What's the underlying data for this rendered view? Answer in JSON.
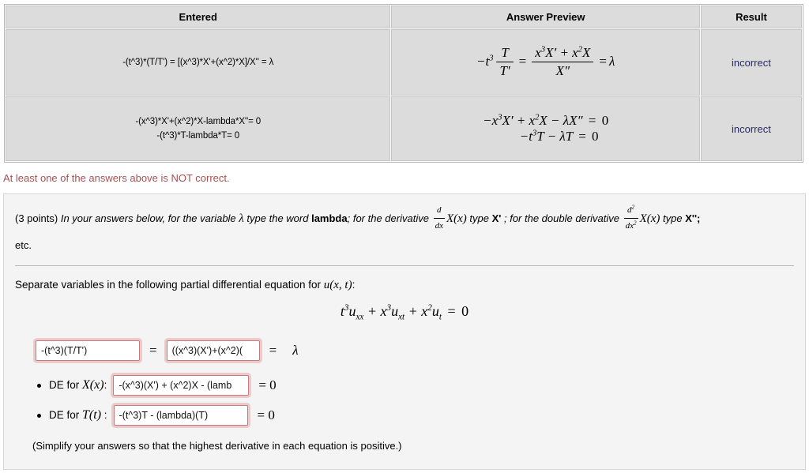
{
  "results_table": {
    "headers": [
      "Entered",
      "Answer Preview",
      "Result"
    ],
    "rows": [
      {
        "entered": "-(t^3)*(T/T') = [(x^3)*X'+(x^2)*X]/X'' = λ",
        "preview_plain": "−t³ T/T′ = (x³X′ + x²X)/X″ = λ",
        "result": "incorrect"
      },
      {
        "entered": "-(x^3)*X'+(x^2)*X-lambda*X''= 0\n-(t^3)*T-lambda*T= 0",
        "preview_plain": "−x³X′ + x²X − λX″ = 0 ; −t³T − λT = 0",
        "result": "incorrect"
      }
    ]
  },
  "warning": {
    "text": "At least one of the answers above is NOT correct."
  },
  "instructions": {
    "points": "(3 points)",
    "lead": "In your answers below, for the variable",
    "lambda_symbol": "λ",
    "type_the_word": "type the word",
    "lambda_word": "lambda",
    "derivative_lead": "; for the derivative",
    "derivative_type": "type",
    "x_prime": "X'",
    "double_lead": "; for the double derivative",
    "double_type": "type",
    "x_double_prime": "X'';",
    "etc": "etc."
  },
  "problem": {
    "prompt_text": "Separate variables in the following partial differential equation for",
    "prompt_fn": "u(x, t)",
    "prompt_colon": ":",
    "equation": "t³u_xx + x³u_xt + x²u_t = 0"
  },
  "answers": {
    "field1_value": "-(t^3)(T/T')",
    "field2_value": "((x^3)(X')+(x^2)(",
    "equals": "=",
    "lambda": "λ",
    "de_x_label_prefix": "DE for",
    "de_x_fn": "X(x)",
    "de_x_colon": ":",
    "field3_value": "-(x^3)(X') + (x^2)X - (lamb",
    "de_t_label_prefix": "DE for",
    "de_t_fn": "T(t)",
    "de_t_colon": " :",
    "field4_value": "-(t^3)T - (lambda)(T)",
    "zero": "= 0"
  },
  "footnote": {
    "text": "(Simplify your answers so that the highest derivative in each equation is positive.)"
  },
  "colors": {
    "incorrect_bg": "#c98b8b",
    "incorrect_text": "#2a2a6a",
    "warning_text": "#a85050",
    "table_cell_bg": "#dcdcdc",
    "panel_bg": "#f4f4f4",
    "field_border": "#c7797e"
  }
}
